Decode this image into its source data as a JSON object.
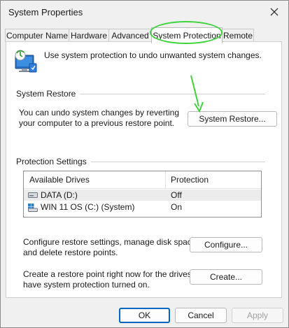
{
  "window": {
    "title": "System Properties"
  },
  "tabs": [
    {
      "label": "Computer Name"
    },
    {
      "label": "Hardware"
    },
    {
      "label": "Advanced"
    },
    {
      "label": "System Protection",
      "active": true
    },
    {
      "label": "Remote"
    }
  ],
  "intro": {
    "text": "Use system protection to undo unwanted system changes."
  },
  "system_restore": {
    "heading": "System Restore",
    "line1": "You can undo system changes by reverting",
    "line2": "your computer to a previous restore point.",
    "button_label": "System Restore..."
  },
  "protection": {
    "heading": "Protection Settings",
    "columns": {
      "drives": "Available Drives",
      "protection": "Protection"
    },
    "drives": [
      {
        "name": "DATA (D:)",
        "protection": "Off",
        "selected": true
      },
      {
        "name": "WIN 11 OS (C:) (System)",
        "protection": "On",
        "selected": false
      }
    ],
    "configure": {
      "line1": "Configure restore settings, manage disk space,",
      "line2": "and delete restore points.",
      "button_label": "Configure..."
    },
    "create": {
      "line1": "Create a restore point right now for the drives that",
      "line2": "have system protection turned on.",
      "button_label": "Create..."
    }
  },
  "footer": {
    "ok_label": "OK",
    "cancel_label": "Cancel",
    "apply_label": "Apply"
  },
  "colors": {
    "annotation": "#3fd33b",
    "primary_border": "#0067c0"
  },
  "icons": {
    "close": "close-icon",
    "system_protection": "system-protection-icon",
    "drive": "drive-icon",
    "system_drive": "system-drive-icon"
  }
}
